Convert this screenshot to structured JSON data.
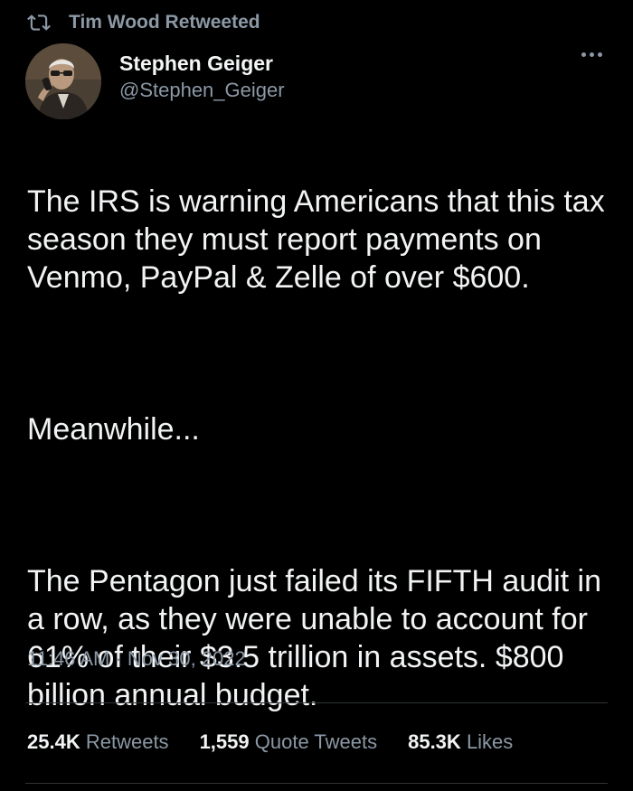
{
  "retweet_banner": {
    "text": "Tim Wood Retweeted",
    "icon": "retweet-icon"
  },
  "author": {
    "name": "Stephen Geiger",
    "handle": "@Stephen_Geiger"
  },
  "tweet": {
    "paragraphs": [
      "The IRS is warning Americans that this tax season they must report payments on Venmo, PayPal & Zelle of over $600.",
      "Meanwhile...",
      "The Pentagon just failed its FIFTH audit in a row, as they were unable to account for 61% of their $3.5 trillion in assets. $800 billion annual budget."
    ],
    "timestamp": "11:46 AM · Nov 30, 2022"
  },
  "stats": {
    "retweets": {
      "count": "25.4K",
      "label": "Retweets"
    },
    "quotes": {
      "count": "1,559",
      "label": "Quote Tweets"
    },
    "likes": {
      "count": "85.3K",
      "label": "Likes"
    }
  },
  "colors": {
    "background": "#000000",
    "text": "#e7e9ea",
    "muted": "#8b98a5",
    "divider": "#2f3336"
  }
}
